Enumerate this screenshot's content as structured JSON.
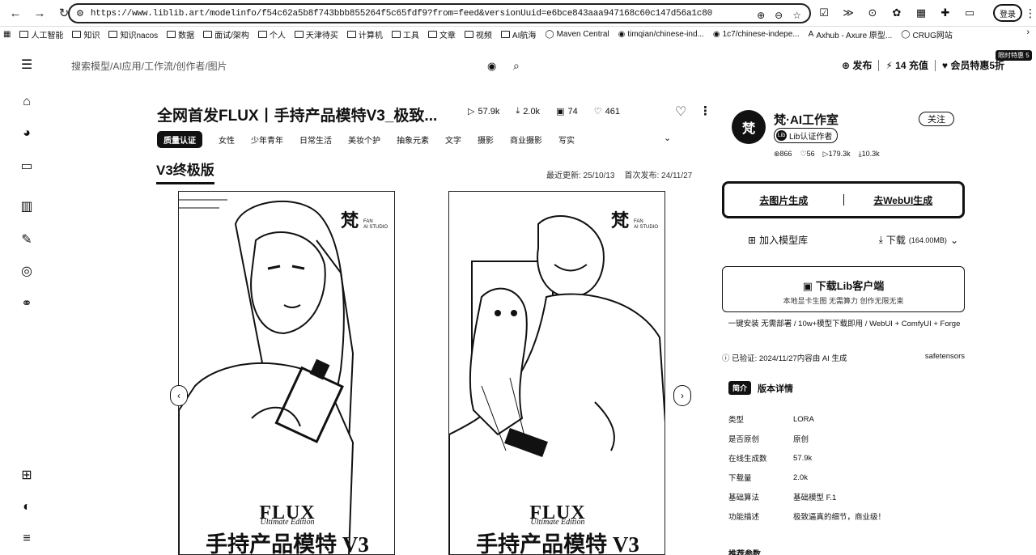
{
  "browser": {
    "url": "https://www.liblib.art/modelinfo/f54c62a5b8f743bbb855264f5c65fdf9?from=feed&versionUuid=e6bce843aaa947168c60c147d56a1c80",
    "profile_label": "登录"
  },
  "bookmarks": [
    {
      "label": "人工智能",
      "icon": "folder-icon"
    },
    {
      "label": "知识",
      "icon": "folder-icon"
    },
    {
      "label": "知识nacos",
      "icon": "folder-icon"
    },
    {
      "label": "数据",
      "icon": "folder-icon"
    },
    {
      "label": "面试/架构",
      "icon": "folder-icon"
    },
    {
      "label": "个人",
      "icon": "folder-icon"
    },
    {
      "label": "天津待买",
      "icon": "folder-icon"
    },
    {
      "label": "计算机",
      "icon": "folder-icon"
    },
    {
      "label": "工具",
      "icon": "folder-icon"
    },
    {
      "label": "文章",
      "icon": "folder-icon"
    },
    {
      "label": "视频",
      "icon": "folder-icon"
    },
    {
      "label": "AI航海",
      "icon": "folder-icon"
    },
    {
      "label": "Maven Central",
      "icon": "globe-icon"
    },
    {
      "label": "timqian/chinese-ind...",
      "icon": "github-icon"
    },
    {
      "label": "1c7/chinese-indepe...",
      "icon": "github-icon"
    },
    {
      "label": "Axhub - Axure 原型...",
      "icon": "axhub-icon"
    },
    {
      "label": "CRUG网站",
      "icon": "globe-icon"
    }
  ],
  "header": {
    "search_placeholder": "搜索模型/AI应用/工作流/创作者/图片",
    "publish_label": "发布",
    "recharge_label": "14 充值",
    "vip_label": "会员特惠5折",
    "vip_tag": "限时特惠 5"
  },
  "model": {
    "title": "全网首发FLUX丨手持产品模特V3_极致...",
    "stats": {
      "runs": "57.9k",
      "downloads": "2.0k",
      "images": "74",
      "likes": "461"
    },
    "quality_badge": "质量认证",
    "tags": [
      "女性",
      "少年青年",
      "日常生活",
      "美妆个护",
      "抽象元素",
      "文字",
      "摄影",
      "商业摄影",
      "写实"
    ],
    "version_tab": "V3终极版",
    "updated_label": "最近更新: 25/10/13",
    "published_label": "首次发布: 24/11/27"
  },
  "cards": [
    {
      "brand": "梵",
      "studio_line1": "FAN",
      "studio_line2": "AI STUDIO",
      "flux": "FLUX",
      "subtitle": "Ultimate Edition",
      "cn_title": "手持产品模特 V3"
    },
    {
      "brand": "梵",
      "studio_line1": "FAN",
      "studio_line2": "AI STUDIO",
      "flux": "FLUX",
      "subtitle": "Ultimate Edition",
      "cn_title": "手持产品模特 V3"
    }
  ],
  "author": {
    "avatar_text": "梵",
    "name": "梵·AI工作室",
    "badge": "Lib认证作者",
    "stats": {
      "followers": "866",
      "likes": "56",
      "runs": "179.3k",
      "downloads": "10.3k"
    },
    "follow_label": "关注"
  },
  "actions": {
    "gen_image": "去图片生成",
    "gen_webui": "去WebUI生成",
    "add_library": "加入模型库",
    "download": "下载",
    "download_size": "(164.00MB)"
  },
  "client": {
    "title": "下载Lib客户端",
    "subtitle": "本地显卡生图 无需算力 创作无限无束",
    "tagline": "一键安装 无需部署 / 10w+模型下载即用 / WebUI + ComfyUI + Forge"
  },
  "verify": {
    "text": "已验证: 2024/11/27内容由 AI 生成",
    "format": "safetensors"
  },
  "details": {
    "pill": "简介",
    "head_label": "版本详情",
    "rows": [
      {
        "k": "类型",
        "v": "LORA"
      },
      {
        "k": "是否原创",
        "v": "原创"
      },
      {
        "k": "在线生成数",
        "v": "57.9k"
      },
      {
        "k": "下载量",
        "v": "2.0k"
      },
      {
        "k": "基础算法",
        "v": "基础模型 F.1"
      },
      {
        "k": "功能描述",
        "v": "极致逼真的细节，商业级！"
      }
    ],
    "more_params": "推荐参数"
  }
}
